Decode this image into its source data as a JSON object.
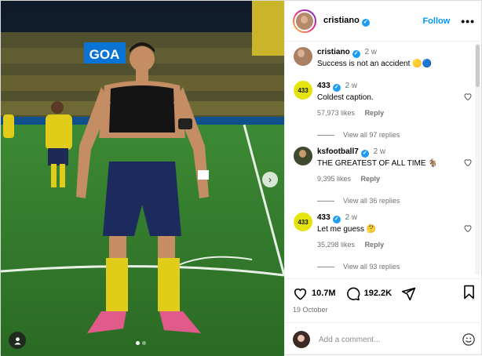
{
  "post_author": {
    "username": "cristiano",
    "follow_label": "Follow",
    "more_label": "•••"
  },
  "photo": {
    "stadium_sign": "GOA",
    "carousel_count": 2,
    "carousel_active": 0,
    "next_icon": "chevron-right-icon",
    "tag_icon": "user-tag-icon"
  },
  "caption": {
    "username": "cristiano",
    "time": "2 w",
    "text": "Success is not an accident 🟡🔵"
  },
  "comments": [
    {
      "username": "433",
      "avatar_label": "433",
      "time": "2 w",
      "text": "Coldest caption.",
      "likes": "57,973 likes",
      "reply_label": "Reply",
      "view_replies": "View all 97 replies"
    },
    {
      "username": "ksfootball7",
      "avatar_label": "",
      "time": "2 w",
      "text": "THE GREATEST OF ALL TIME 🐐",
      "likes": "9,395 likes",
      "reply_label": "Reply",
      "view_replies": "View all 36 replies"
    },
    {
      "username": "433",
      "avatar_label": "433",
      "time": "2 w",
      "text": "Let me guess 🤔",
      "likes": "35,298 likes",
      "reply_label": "Reply",
      "view_replies": "View all 93 replies"
    }
  ],
  "actions": {
    "likes": "10.7M",
    "comments": "192.2K",
    "date": "19 October"
  },
  "add_comment": {
    "placeholder": "Add a comment..."
  },
  "colors": {
    "accent": "#0095f6",
    "verified": "#1d9bf0",
    "muted": "#737373"
  }
}
